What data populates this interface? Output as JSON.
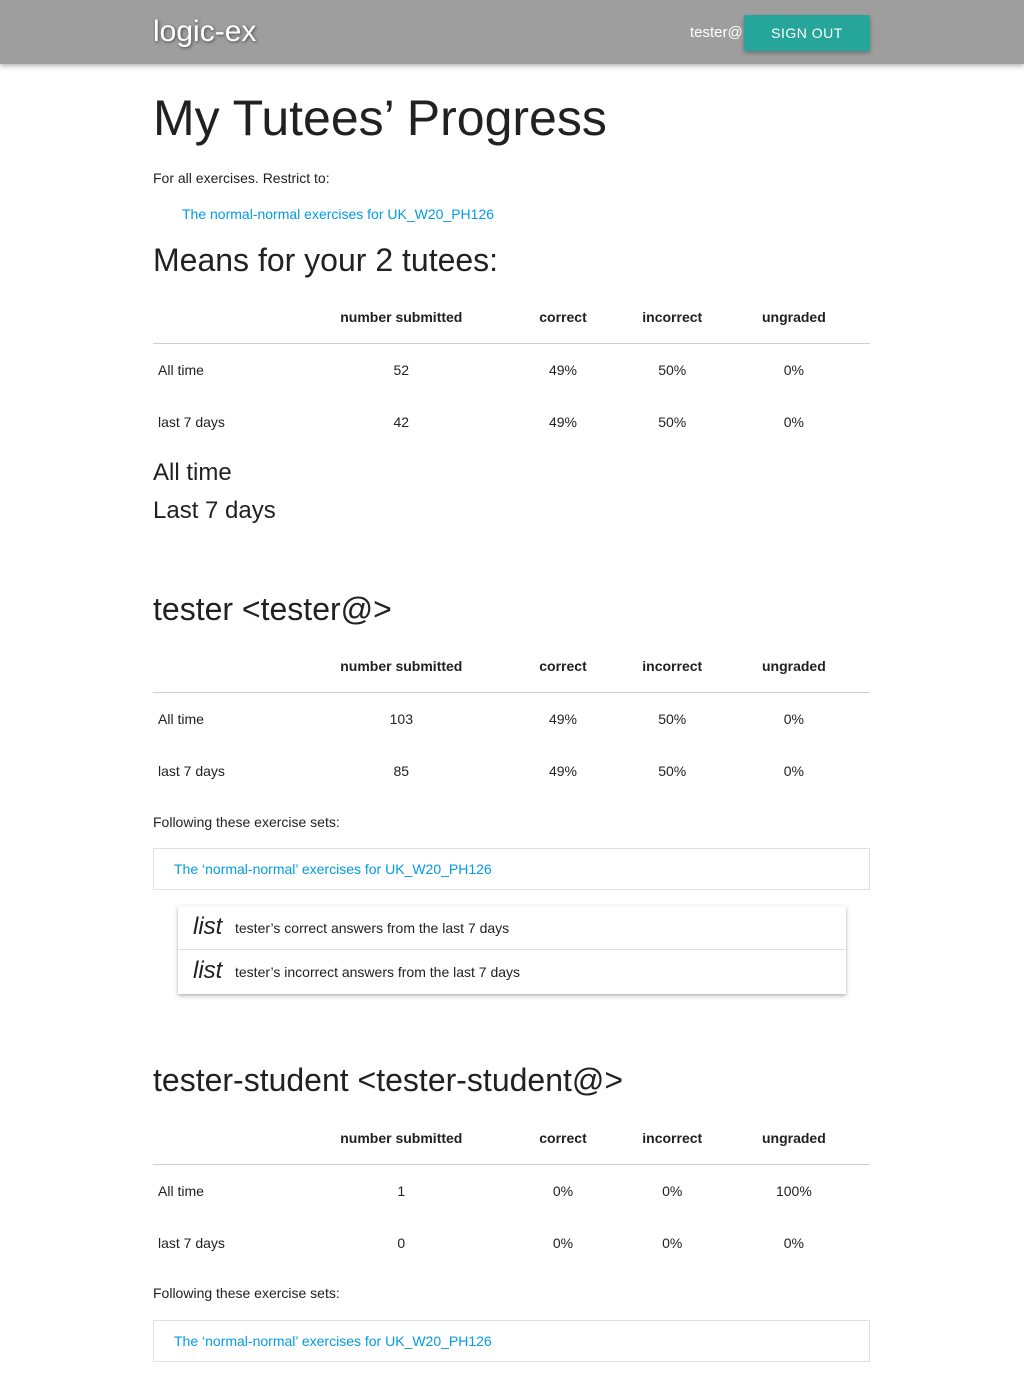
{
  "navbar": {
    "brand": "logic-ex",
    "user": "tester@",
    "signout": "SIGN OUT"
  },
  "page": {
    "title": "My Tutees’ Progress",
    "intro": "For all exercises. Restrict to:",
    "restrict_link": "The normal-normal exercises for UK_W20_PH126"
  },
  "table_headers": [
    "number submitted",
    "correct",
    "incorrect",
    "ungraded"
  ],
  "means": {
    "heading": "Means for your 2 tutees:",
    "rows": [
      {
        "label": "All time",
        "submitted": "52",
        "correct": "49%",
        "incorrect": "50%",
        "ungraded": "0%"
      },
      {
        "label": "last 7 days",
        "submitted": "42",
        "correct": "49%",
        "incorrect": "50%",
        "ungraded": "0%"
      }
    ],
    "sub1": "All time",
    "sub2": "Last 7 days"
  },
  "tutees": [
    {
      "heading": "tester <tester@>",
      "rows": [
        {
          "label": "All time",
          "submitted": "103",
          "correct": "49%",
          "incorrect": "50%",
          "ungraded": "0%"
        },
        {
          "label": "last 7 days",
          "submitted": "85",
          "correct": "49%",
          "incorrect": "50%",
          "ungraded": "0%"
        }
      ],
      "following": "Following these exercise sets:",
      "set_link": "The ‘normal-normal’ exercises for UK_W20_PH126",
      "list_items": [
        {
          "word": "list",
          "text": "tester’s correct answers from the last 7 days"
        },
        {
          "word": "list",
          "text": "tester’s incorrect answers from the last 7 days"
        }
      ]
    },
    {
      "heading": "tester-student <tester-student@>",
      "rows": [
        {
          "label": "All time",
          "submitted": "1",
          "correct": "0%",
          "incorrect": "0%",
          "ungraded": "100%"
        },
        {
          "label": "last 7 days",
          "submitted": "0",
          "correct": "0%",
          "incorrect": "0%",
          "ungraded": "0%"
        }
      ],
      "following": "Following these exercise sets:",
      "set_link": "The ‘normal-normal’ exercises for UK_W20_PH126"
    }
  ]
}
